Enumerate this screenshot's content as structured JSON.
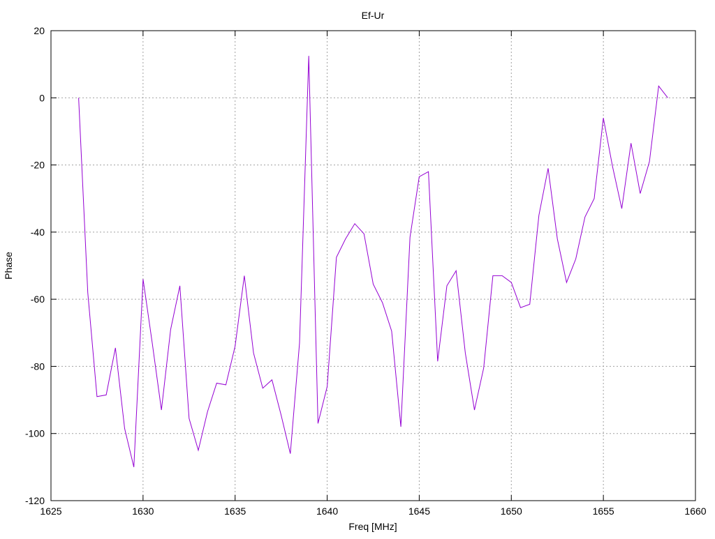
{
  "chart_data": {
    "type": "line",
    "title": "Ef-Ur",
    "xlabel": "Freq [MHz]",
    "ylabel": "Phase",
    "xlim": [
      1625,
      1660
    ],
    "ylim": [
      -120,
      20
    ],
    "xticks": [
      1625,
      1630,
      1635,
      1640,
      1645,
      1650,
      1655,
      1660
    ],
    "yticks": [
      -120,
      -100,
      -80,
      -60,
      -40,
      -20,
      0,
      20
    ],
    "grid": true,
    "legend": "none",
    "series": [
      {
        "color": "#9400d3",
        "x": [
          1626.5,
          1627.0,
          1627.5,
          1628.0,
          1628.5,
          1629.0,
          1629.5,
          1630.0,
          1630.5,
          1631.0,
          1631.5,
          1632.0,
          1632.5,
          1633.0,
          1633.5,
          1634.0,
          1634.5,
          1635.0,
          1635.5,
          1636.0,
          1636.5,
          1637.0,
          1637.5,
          1638.0,
          1638.5,
          1639.0,
          1639.5,
          1640.0,
          1640.5,
          1641.0,
          1641.5,
          1642.0,
          1642.5,
          1643.0,
          1643.5,
          1644.0,
          1644.5,
          1645.0,
          1645.5,
          1646.0,
          1646.5,
          1647.0,
          1647.5,
          1648.0,
          1648.5,
          1649.0,
          1649.5,
          1650.0,
          1650.5,
          1651.0,
          1651.5,
          1652.0,
          1652.5,
          1653.0,
          1653.5,
          1654.0,
          1654.5,
          1655.0,
          1655.5,
          1656.0,
          1656.5,
          1657.0,
          1657.5,
          1658.0,
          1658.5
        ],
        "y": [
          0,
          -58,
          -89,
          -88.5,
          -74.5,
          -98.5,
          -110,
          -54,
          -73,
          -93,
          -69,
          -56,
          -95.5,
          -105,
          -93.5,
          -85,
          -85.5,
          -74,
          -53,
          -76,
          -86.5,
          -84,
          -94.5,
          -106,
          -73,
          12.5,
          -97,
          -86,
          -47.5,
          -42,
          -37.5,
          -40.5,
          -55.5,
          -61,
          -69.5,
          -98,
          -41.5,
          -23.5,
          -22,
          -78.5,
          -56,
          -51.5,
          -76,
          -93,
          -80.5,
          -53,
          -53,
          -55,
          -62.5,
          -61.5,
          -35,
          -21,
          -42,
          -55,
          -48,
          -35.5,
          -30,
          -6,
          -20.5,
          -33,
          -13.5,
          -28.5,
          -19,
          3.5,
          0
        ]
      }
    ]
  }
}
